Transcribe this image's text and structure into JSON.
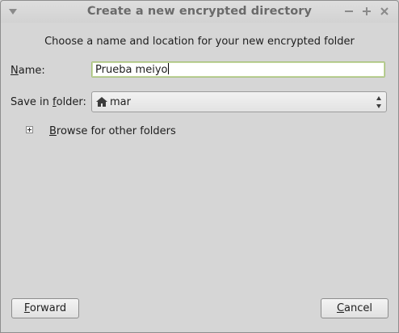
{
  "window": {
    "title": "Create a new encrypted directory",
    "controls": [
      "minimize",
      "maximize",
      "close"
    ]
  },
  "dialog": {
    "intro": "Choose a name and location for your new encrypted folder",
    "name_label_mnemonic": "N",
    "name_label_rest": "ame:",
    "name_value": "Prueba meiyo",
    "save_label_prefix": "Save in ",
    "save_label_mnemonic": "f",
    "save_label_rest": "older:",
    "folder_icon": "home-folder-icon",
    "folder_value": "mar",
    "browse_mnemonic": "B",
    "browse_rest": "rowse for other folders"
  },
  "buttons": {
    "forward_mnemonic": "F",
    "forward_rest": "orward",
    "cancel_mnemonic": "C",
    "cancel_rest": "ancel"
  },
  "colors": {
    "window_bg": "#d6d6d6",
    "title_text": "#6a6a6a",
    "input_focus_border": "#a6c07a"
  }
}
